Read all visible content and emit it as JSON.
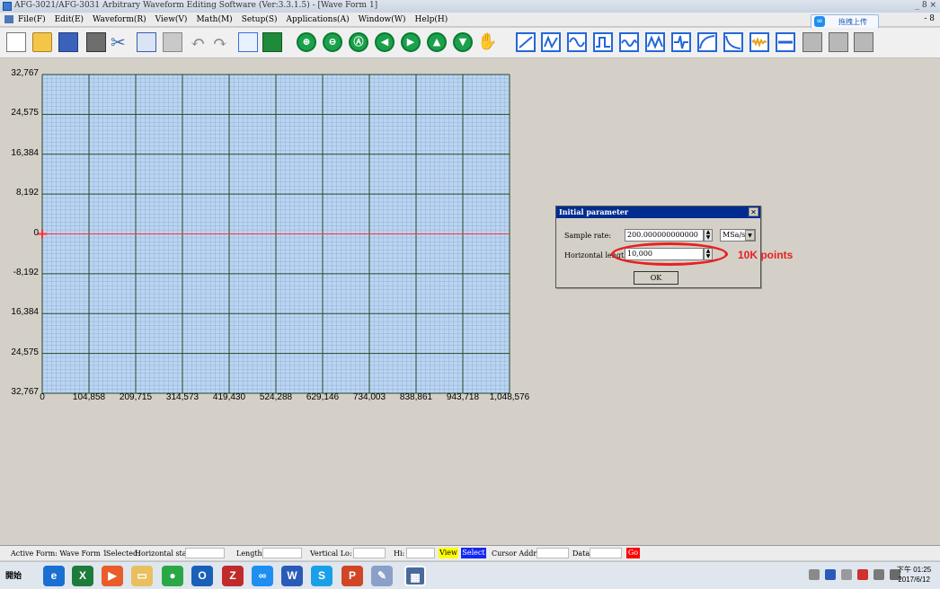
{
  "window": {
    "title": "AFG-3021/AFG-3031 Arbitrary Waveform Editing Software (Ver:3.3.1.5) - [Wave Form 1]",
    "controls": "_ 8 ×"
  },
  "menu": {
    "items": [
      "File(F)",
      "Edit(E)",
      "Waveform(R)",
      "View(V)",
      "Math(M)",
      "Setup(S)",
      "Applications(A)",
      "Window(W)",
      "Help(H)"
    ],
    "cloud_label": "拖拽上传",
    "mdi_controls": "- 8"
  },
  "toolbar": {
    "circle_button_glyphs": [
      "⊕",
      "⊖",
      "Ⓐ",
      "◀",
      "▶",
      "▲",
      "▼"
    ]
  },
  "chart_data": {
    "type": "line",
    "y_ticks": [
      "32,767",
      "24,575",
      "16,384",
      "8,192",
      "0",
      "-8,192",
      "16,384",
      "24,575",
      "32,767"
    ],
    "y_values": [
      32767,
      24575,
      16384,
      8192,
      0,
      -8192,
      -16384,
      -24575,
      -32767
    ],
    "x_ticks": [
      "0",
      "104,858",
      "209,715",
      "314,573",
      "419,430",
      "524,288",
      "629,146",
      "734,003",
      "838,861",
      "943,718",
      "1,048,576"
    ],
    "x_values": [
      0,
      104858,
      209715,
      314573,
      419430,
      524288,
      629146,
      734003,
      838861,
      943718,
      1048576
    ],
    "xlim": [
      0,
      1048576
    ],
    "ylim": [
      -32767,
      32767
    ],
    "series": [
      {
        "x": [
          0,
          1048576
        ],
        "y": [
          0,
          0
        ]
      }
    ],
    "grid": true,
    "colors": {
      "background": "#bcd4f0",
      "minor_grid": "#8fb0dd",
      "major_grid": "#1e4a2a",
      "zero_line": "#ff3030"
    }
  },
  "dialog": {
    "title": "Initial parameter",
    "sample_rate_label": "Sample rate:",
    "sample_rate_value": "200.000000000000",
    "sample_rate_unit": "MSa/s",
    "horizontal_length_label": "Horizontal length:",
    "horizontal_length_value": "10,000",
    "ok_label": "OK"
  },
  "annotation": {
    "text": "10K points",
    "color": "#e82020"
  },
  "statusbar": {
    "active_form": "Active Form: Wave Form 1",
    "selected": "Selected:",
    "horizontal_start": "Horizontal start:",
    "length": "Length:",
    "vertical_lo": "Vertical Lo:",
    "hi": "Hi:",
    "view": "View",
    "select": "Select",
    "cursor_addr": "Cursor Addr.:",
    "data": "Data:",
    "go": "Go"
  },
  "taskbar": {
    "start_label": "開始",
    "time": "下午 01:25",
    "date": "2017/6/12"
  }
}
